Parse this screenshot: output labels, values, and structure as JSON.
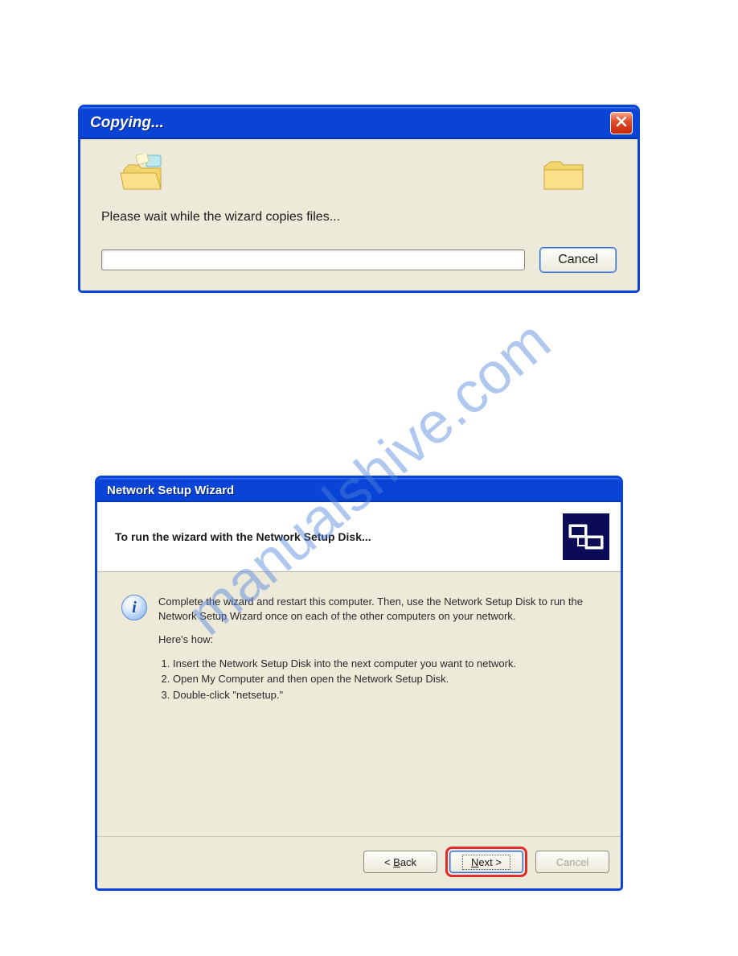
{
  "watermark": "manualshive.com",
  "dialog1": {
    "title": "Copying...",
    "message": "Please wait while the wizard copies files...",
    "cancel_label": "Cancel"
  },
  "dialog2": {
    "title": "Network Setup Wizard",
    "header": "To run the wizard with the Network Setup Disk...",
    "info_paragraph": "Complete the wizard and restart this computer. Then, use the Network Setup Disk to run the Network Setup Wizard once on each of the other computers on your network.",
    "heres_how": "Here's how:",
    "steps": [
      "Insert the Network Setup Disk into the next computer you want to network.",
      "Open My Computer and then open the Network Setup Disk.",
      "Double-click \"netsetup.\""
    ],
    "back_prefix": "< ",
    "back_mn": "B",
    "back_rest": "ack",
    "next_mn": "N",
    "next_rest": "ext >",
    "cancel_label": "Cancel"
  }
}
